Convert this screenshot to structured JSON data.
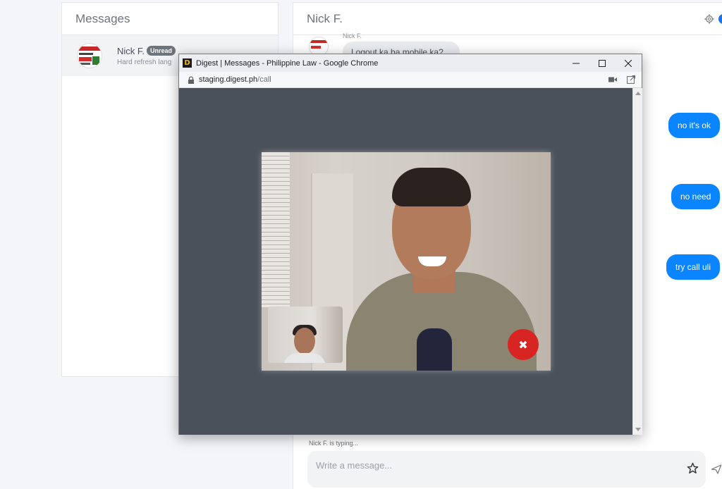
{
  "messages_panel": {
    "title": "Messages",
    "threads": [
      {
        "name": "Nick F.",
        "badge": "Unread",
        "preview": "Hard refresh lang"
      }
    ]
  },
  "chat": {
    "title": "Nick F.",
    "incoming": {
      "sender": "Nick F.",
      "text": "Logout ka ba mobile ka?"
    },
    "outgoing": [
      "no it's ok",
      "no need",
      "try call uli"
    ],
    "typing": "Nick F. is typing...",
    "composer_placeholder": "Write a message...",
    "accent_color": "#0a84ff"
  },
  "popup": {
    "favicon_letter": "D",
    "window_title": "Digest | Messages - Philippine Law - Google Chrome",
    "url_host": "staging.digest.ph",
    "url_path": "/call",
    "end_call_symbol": "✖",
    "end_call_color": "#d92424"
  },
  "icons": [
    "gear-icon",
    "star-icon",
    "send-icon",
    "lock-icon",
    "camera-icon",
    "open-external-icon",
    "close-icon"
  ]
}
